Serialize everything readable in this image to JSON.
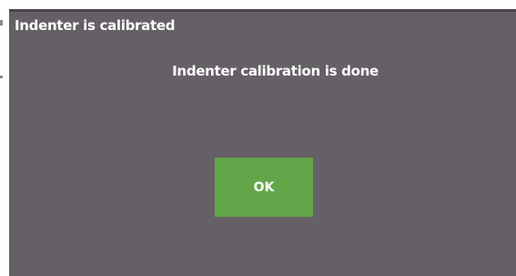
{
  "dialog": {
    "title": "Indenter is calibrated",
    "message": "Indenter calibration is done",
    "ok_label": "OK"
  },
  "colors": {
    "dialog_background": "#656066",
    "button_background": "#63a64a",
    "text": "#ffffff"
  }
}
